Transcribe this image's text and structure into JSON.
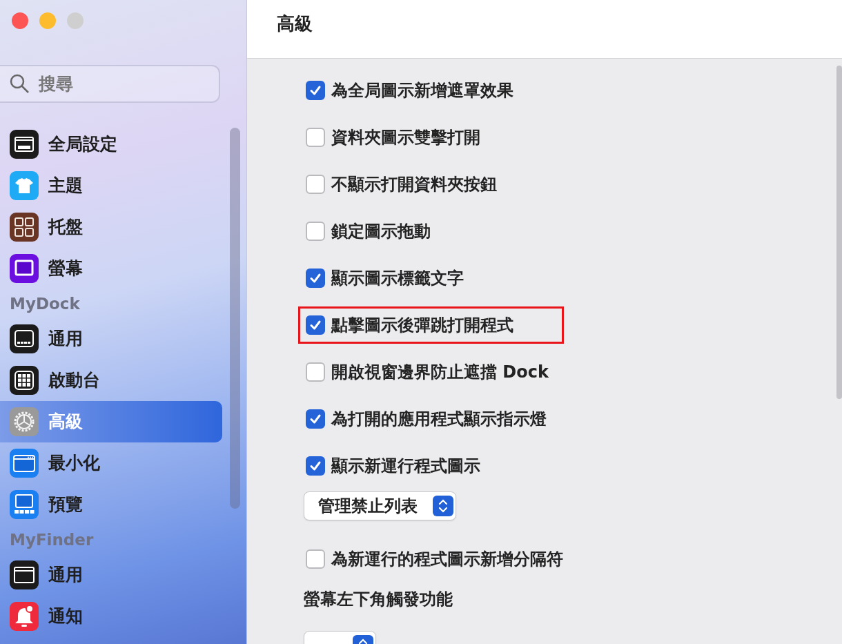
{
  "sidebar": {
    "search": {
      "placeholder": "搜尋"
    },
    "items": [
      {
        "kind": "item",
        "label": "全局設定",
        "selected": false
      },
      {
        "kind": "item",
        "label": "主題",
        "selected": false
      },
      {
        "kind": "item",
        "label": "托盤",
        "selected": false
      },
      {
        "kind": "item",
        "label": "螢幕",
        "selected": false
      },
      {
        "kind": "section",
        "label": "MyDock"
      },
      {
        "kind": "item",
        "label": "通用",
        "selected": false
      },
      {
        "kind": "item",
        "label": "啟動台",
        "selected": false
      },
      {
        "kind": "item",
        "label": "高級",
        "selected": true
      },
      {
        "kind": "item",
        "label": "最小化",
        "selected": false
      },
      {
        "kind": "item",
        "label": "預覽",
        "selected": false
      },
      {
        "kind": "section",
        "label": "MyFinder"
      },
      {
        "kind": "item",
        "label": "通用",
        "selected": false
      },
      {
        "kind": "item",
        "label": "通知",
        "selected": false
      }
    ]
  },
  "header": {
    "title": "高級"
  },
  "settings": [
    {
      "kind": "checkbox",
      "label": "為全局圖示新增遮罩效果",
      "checked": true,
      "highlighted": false
    },
    {
      "kind": "checkbox",
      "label": "資料夾圖示雙擊打開",
      "checked": false,
      "highlighted": false
    },
    {
      "kind": "checkbox",
      "label": "不顯示打開資料夾按鈕",
      "checked": false,
      "highlighted": false
    },
    {
      "kind": "checkbox",
      "label": "鎖定圖示拖動",
      "checked": false,
      "highlighted": false
    },
    {
      "kind": "checkbox",
      "label": "顯示圖示標籤文字",
      "checked": true,
      "highlighted": false
    },
    {
      "kind": "checkbox",
      "label": "點擊圖示後彈跳打開程式",
      "checked": true,
      "highlighted": true
    },
    {
      "kind": "checkbox",
      "label": "開啟視窗邊界防止遮擋 Dock",
      "checked": false,
      "highlighted": false
    },
    {
      "kind": "checkbox",
      "label": "為打開的應用程式顯示指示燈",
      "checked": true,
      "highlighted": false
    },
    {
      "kind": "checkbox",
      "label": "顯示新運行程式圖示",
      "checked": true,
      "highlighted": false
    },
    {
      "kind": "popup",
      "value": "管理禁止列表"
    },
    {
      "kind": "checkbox",
      "label": "為新運行的程式圖示新增分隔符",
      "checked": false,
      "highlighted": false
    },
    {
      "kind": "label",
      "label": "螢幕左下角觸發功能"
    },
    {
      "kind": "popup"
    }
  ]
}
